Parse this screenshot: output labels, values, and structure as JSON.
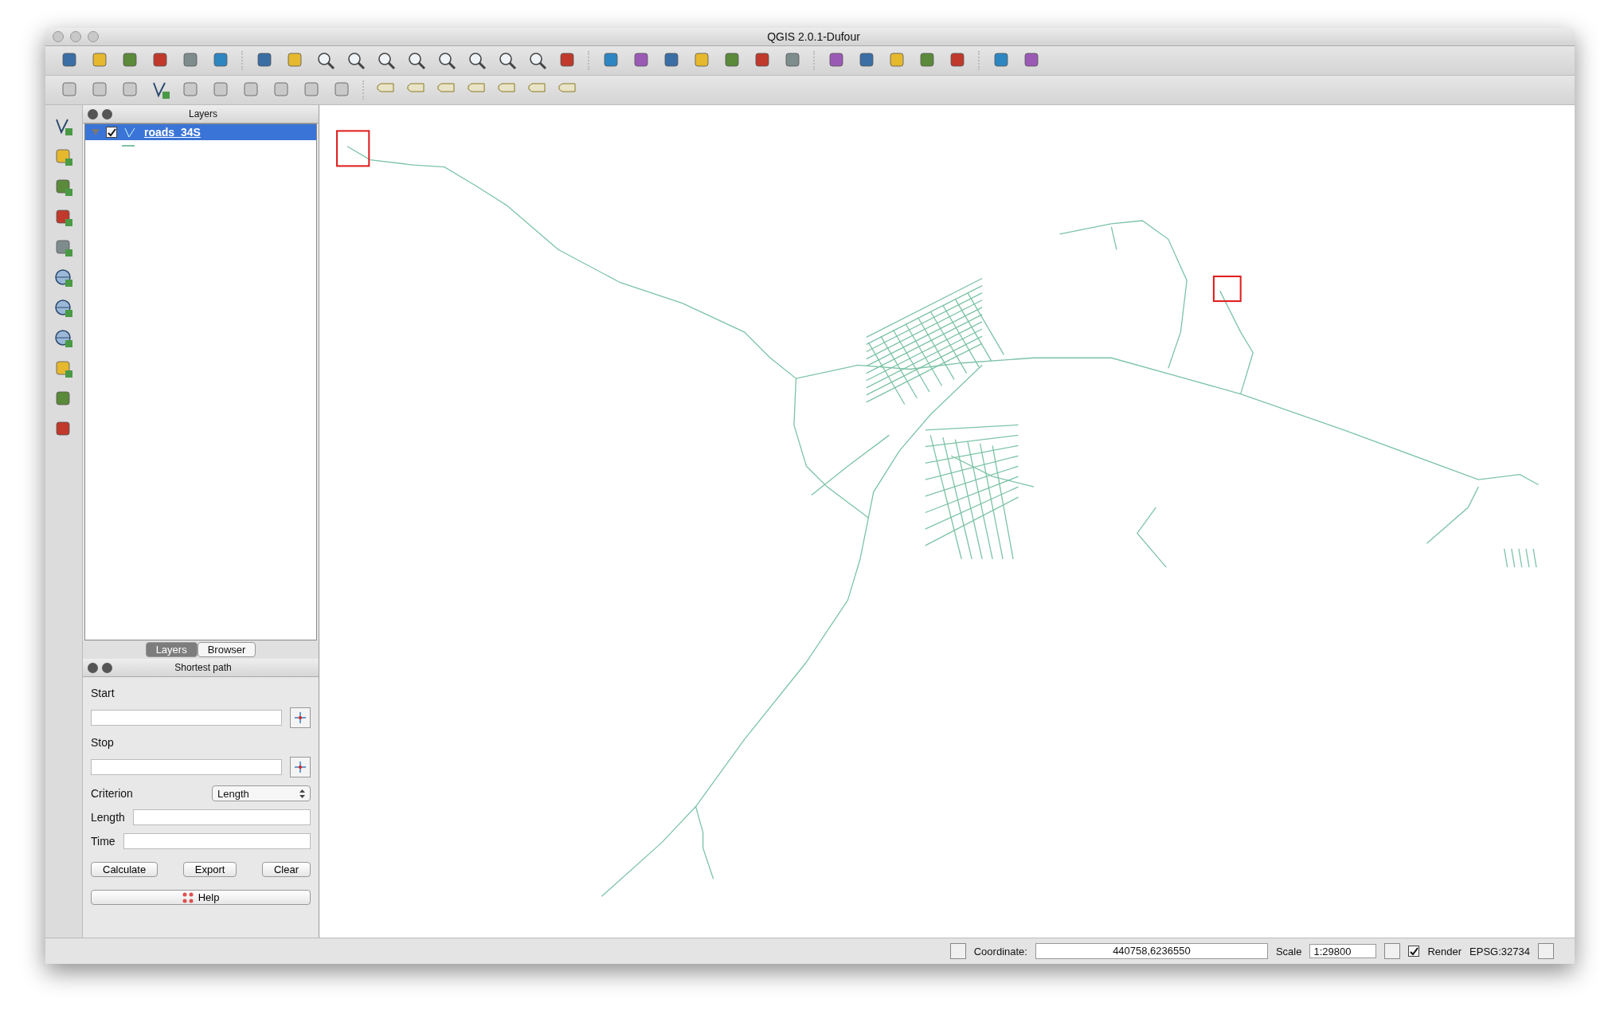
{
  "window": {
    "title": "QGIS 2.0.1-Dufour"
  },
  "layers_panel": {
    "title": "Layers",
    "layers": [
      {
        "name": "roads_34S",
        "checked": true,
        "expanded": true,
        "selected": true
      }
    ]
  },
  "panel_tabs": [
    {
      "label": "Layers",
      "selected": true
    },
    {
      "label": "Browser",
      "selected": false
    }
  ],
  "shortest_path": {
    "title": "Shortest path",
    "start_label": "Start",
    "stop_label": "Stop",
    "criterion_label": "Criterion",
    "criterion_value": "Length",
    "length_label": "Length",
    "time_label": "Time",
    "buttons": [
      "Calculate",
      "Export",
      "Clear"
    ],
    "help": "Help"
  },
  "status_bar": {
    "coordinate_label": "Coordinate:",
    "coordinate": "440758,6236550",
    "scale_label": "Scale",
    "scale": "1:29800",
    "render_label": "Render",
    "render_checked": true,
    "crs": "EPSG:32734"
  }
}
